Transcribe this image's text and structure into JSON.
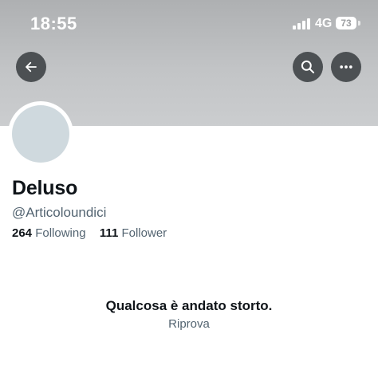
{
  "status_bar": {
    "time": "18:55",
    "network": "4G",
    "battery": "73",
    "icons": [
      "signal-bars-icon",
      "battery-icon"
    ]
  },
  "header": {
    "back_icon": "arrow-left-icon",
    "search_icon": "search-icon",
    "more_icon": "more-horizontal-icon",
    "banner_color": "#b8babc"
  },
  "profile": {
    "display_name": "Deluso",
    "handle": "@Articoloundici",
    "following_count": "264",
    "following_label": "Following",
    "followers_count": "111",
    "followers_label": "Follower",
    "avatar_color": "#cfd9de"
  },
  "error": {
    "title": "Qualcosa è andato storto.",
    "retry_label": "Riprova"
  },
  "colors": {
    "text_primary": "#0f1419",
    "text_secondary": "#536471",
    "header_button": "#4c5053"
  }
}
